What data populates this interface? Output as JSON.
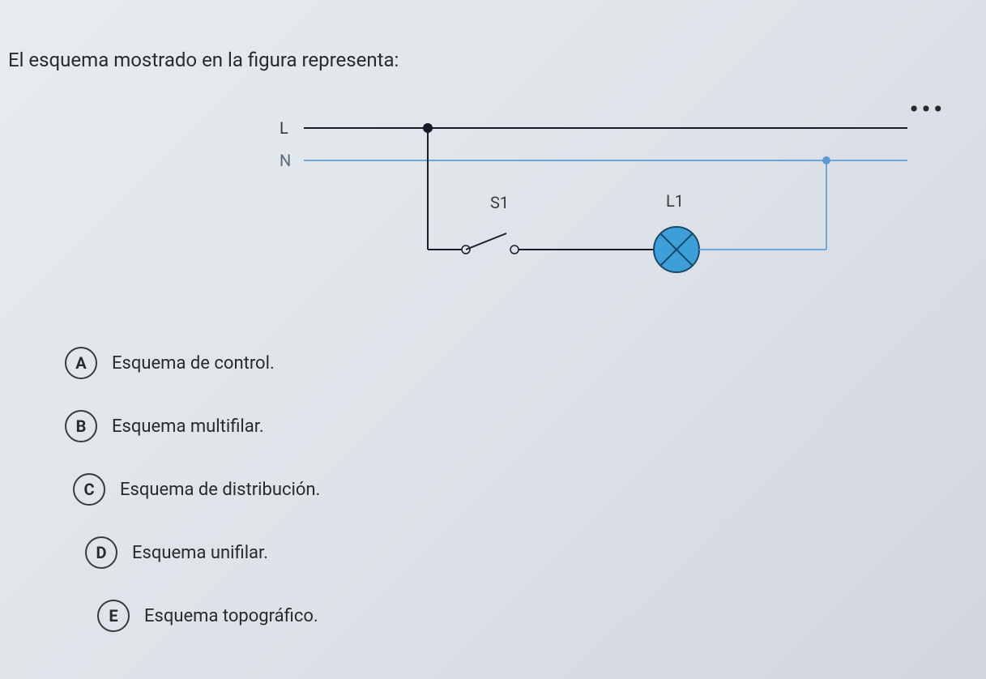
{
  "question": "El esquema mostrado en la figura representa:",
  "diagram": {
    "labels": {
      "line": "L",
      "neutral": "N",
      "switch": "S1",
      "lamp": "L1"
    },
    "dots": "•••"
  },
  "options": [
    {
      "letter": "A",
      "text": "Esquema de control."
    },
    {
      "letter": "B",
      "text": "Esquema multifilar."
    },
    {
      "letter": "C",
      "text": "Esquema de distribución."
    },
    {
      "letter": "D",
      "text": "Esquema unifilar."
    },
    {
      "letter": "E",
      "text": "Esquema topográfico."
    }
  ]
}
